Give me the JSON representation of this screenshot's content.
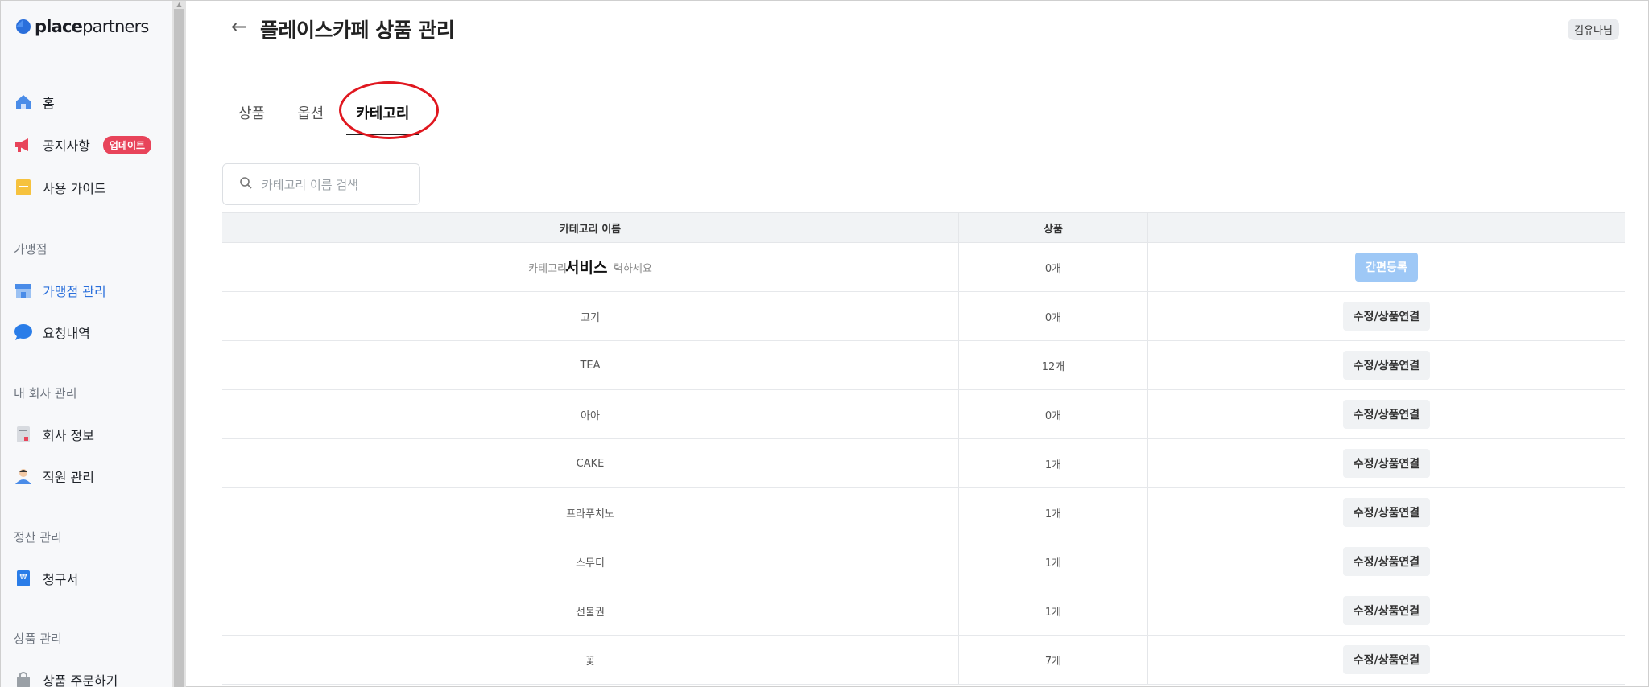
{
  "brand": {
    "bold": "place",
    "rest": "partners"
  },
  "header": {
    "title": "플레이스카페 상품 관리",
    "user": "김유나님",
    "back_arrow": "←"
  },
  "sidebar": {
    "items": [
      {
        "label": "홈",
        "icon": "home-icon"
      },
      {
        "label": "공지사항",
        "icon": "megaphone-icon",
        "badge": "업데이트"
      },
      {
        "label": "사용 가이드",
        "icon": "guide-icon"
      }
    ],
    "sections": [
      {
        "title": "가맹점",
        "items": [
          {
            "label": "가맹점 관리",
            "icon": "store-icon",
            "active": true
          },
          {
            "label": "요청내역",
            "icon": "chat-bubble-icon"
          }
        ]
      },
      {
        "title": "내 회사 관리",
        "items": [
          {
            "label": "회사 정보",
            "icon": "document-icon"
          },
          {
            "label": "직원 관리",
            "icon": "person-icon"
          }
        ]
      },
      {
        "title": "정산 관리",
        "items": [
          {
            "label": "청구서",
            "icon": "invoice-icon"
          }
        ]
      },
      {
        "title": "상품 관리",
        "items": [
          {
            "label": "상품 주문하기",
            "icon": "bag-icon"
          }
        ]
      }
    ]
  },
  "tabs": [
    {
      "label": "상품"
    },
    {
      "label": "옵션"
    },
    {
      "label": "카테고리",
      "active": true
    }
  ],
  "search": {
    "placeholder": "카테고리 이름 검색"
  },
  "table": {
    "headers": [
      "카테고리 이름",
      "상품",
      ""
    ],
    "new_row": {
      "placeholder_left": "카테고리",
      "placeholder_right": "력하세요",
      "typed_text": "서비스",
      "count": "0개",
      "button": "간편등록"
    },
    "rows": [
      {
        "name": "고기",
        "count": "0개",
        "button": "수정/상품연결"
      },
      {
        "name": "TEA",
        "count": "12개",
        "button": "수정/상품연결"
      },
      {
        "name": "아아",
        "count": "0개",
        "button": "수정/상품연결"
      },
      {
        "name": "CAKE",
        "count": "1개",
        "button": "수정/상품연결"
      },
      {
        "name": "프라푸치노",
        "count": "1개",
        "button": "수정/상품연결"
      },
      {
        "name": "스무디",
        "count": "1개",
        "button": "수정/상품연결"
      },
      {
        "name": "선불권",
        "count": "1개",
        "button": "수정/상품연결"
      },
      {
        "name": "꽃",
        "count": "7개",
        "button": "수정/상품연결"
      }
    ]
  },
  "colors": {
    "accent": "#2a6fdb",
    "badge": "#e8445a",
    "annotation": "#e0171f",
    "quick_button": "#9ec8f6"
  }
}
